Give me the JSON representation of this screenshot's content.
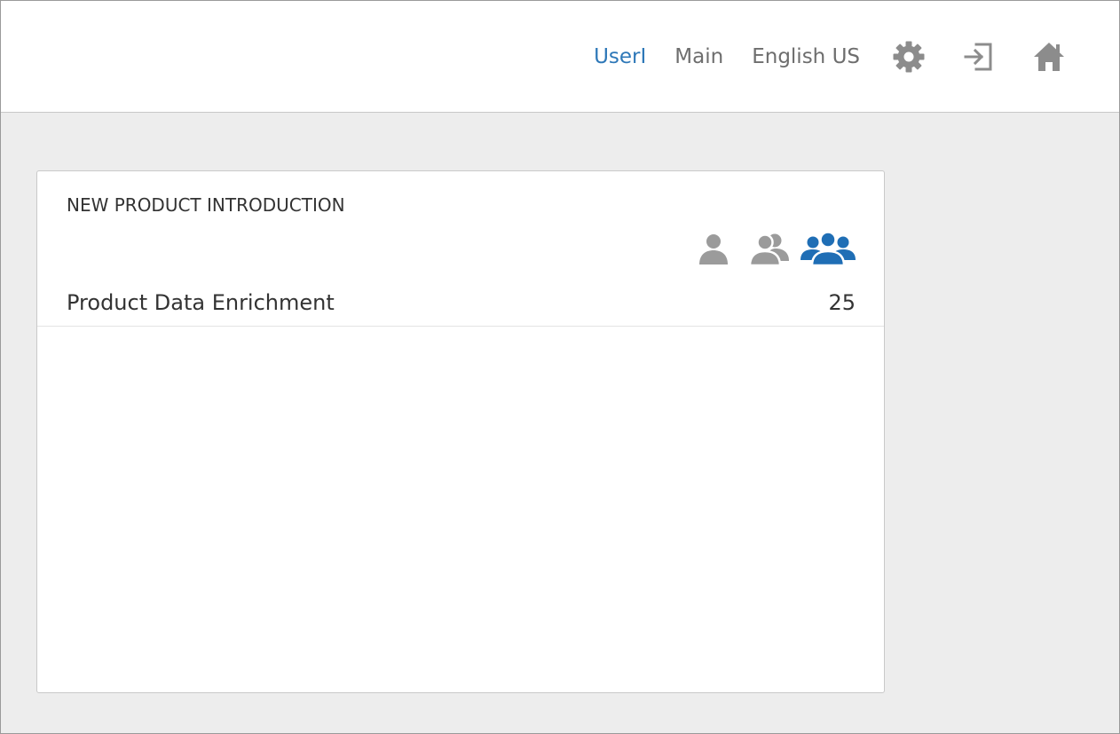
{
  "header": {
    "user": "UserI",
    "context": "Main",
    "language": "English US",
    "icons": {
      "settings": "gear-icon",
      "logout": "sign-out-icon",
      "home": "home-icon"
    }
  },
  "card": {
    "title": "NEW PRODUCT INTRODUCTION",
    "scope_icons": [
      "single-user-icon",
      "two-users-icon",
      "group-users-icon"
    ],
    "active_scope": "group-users-icon",
    "items": [
      {
        "label": "Product Data Enrichment",
        "count": "25"
      }
    ]
  },
  "colors": {
    "accent": "#1f6eb5",
    "icon_gray": "#9b9b9b",
    "text": "#333333",
    "background": "#ededed"
  }
}
